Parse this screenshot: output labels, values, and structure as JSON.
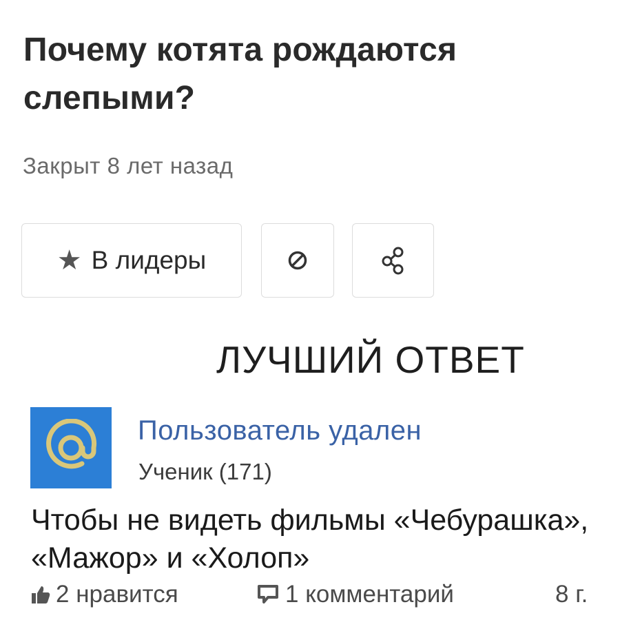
{
  "question": {
    "title": "Почему котята рождаются слепыми?",
    "status": "Закрыт 8 лет назад"
  },
  "actions": {
    "leaders_label": "В лидеры",
    "star_icon": "star-icon",
    "block_icon": "block-icon",
    "share_icon": "share-icon"
  },
  "best_answer": {
    "heading": "ЛУЧШИЙ ОТВЕТ",
    "author": {
      "name": "Пользователь удален",
      "rank": "Ученик (171)",
      "avatar_icon": "at-sign-icon"
    },
    "text": "Чтобы не видеть фильмы «Чебурашка», «Мажор» и «Холоп»",
    "likes": "2 нравится",
    "comments": "1 комментарий",
    "time": "8 г."
  },
  "colors": {
    "avatar_bg": "#2c7fd6",
    "avatar_symbol": "#d9c77a",
    "author_link": "#3a62a6"
  }
}
